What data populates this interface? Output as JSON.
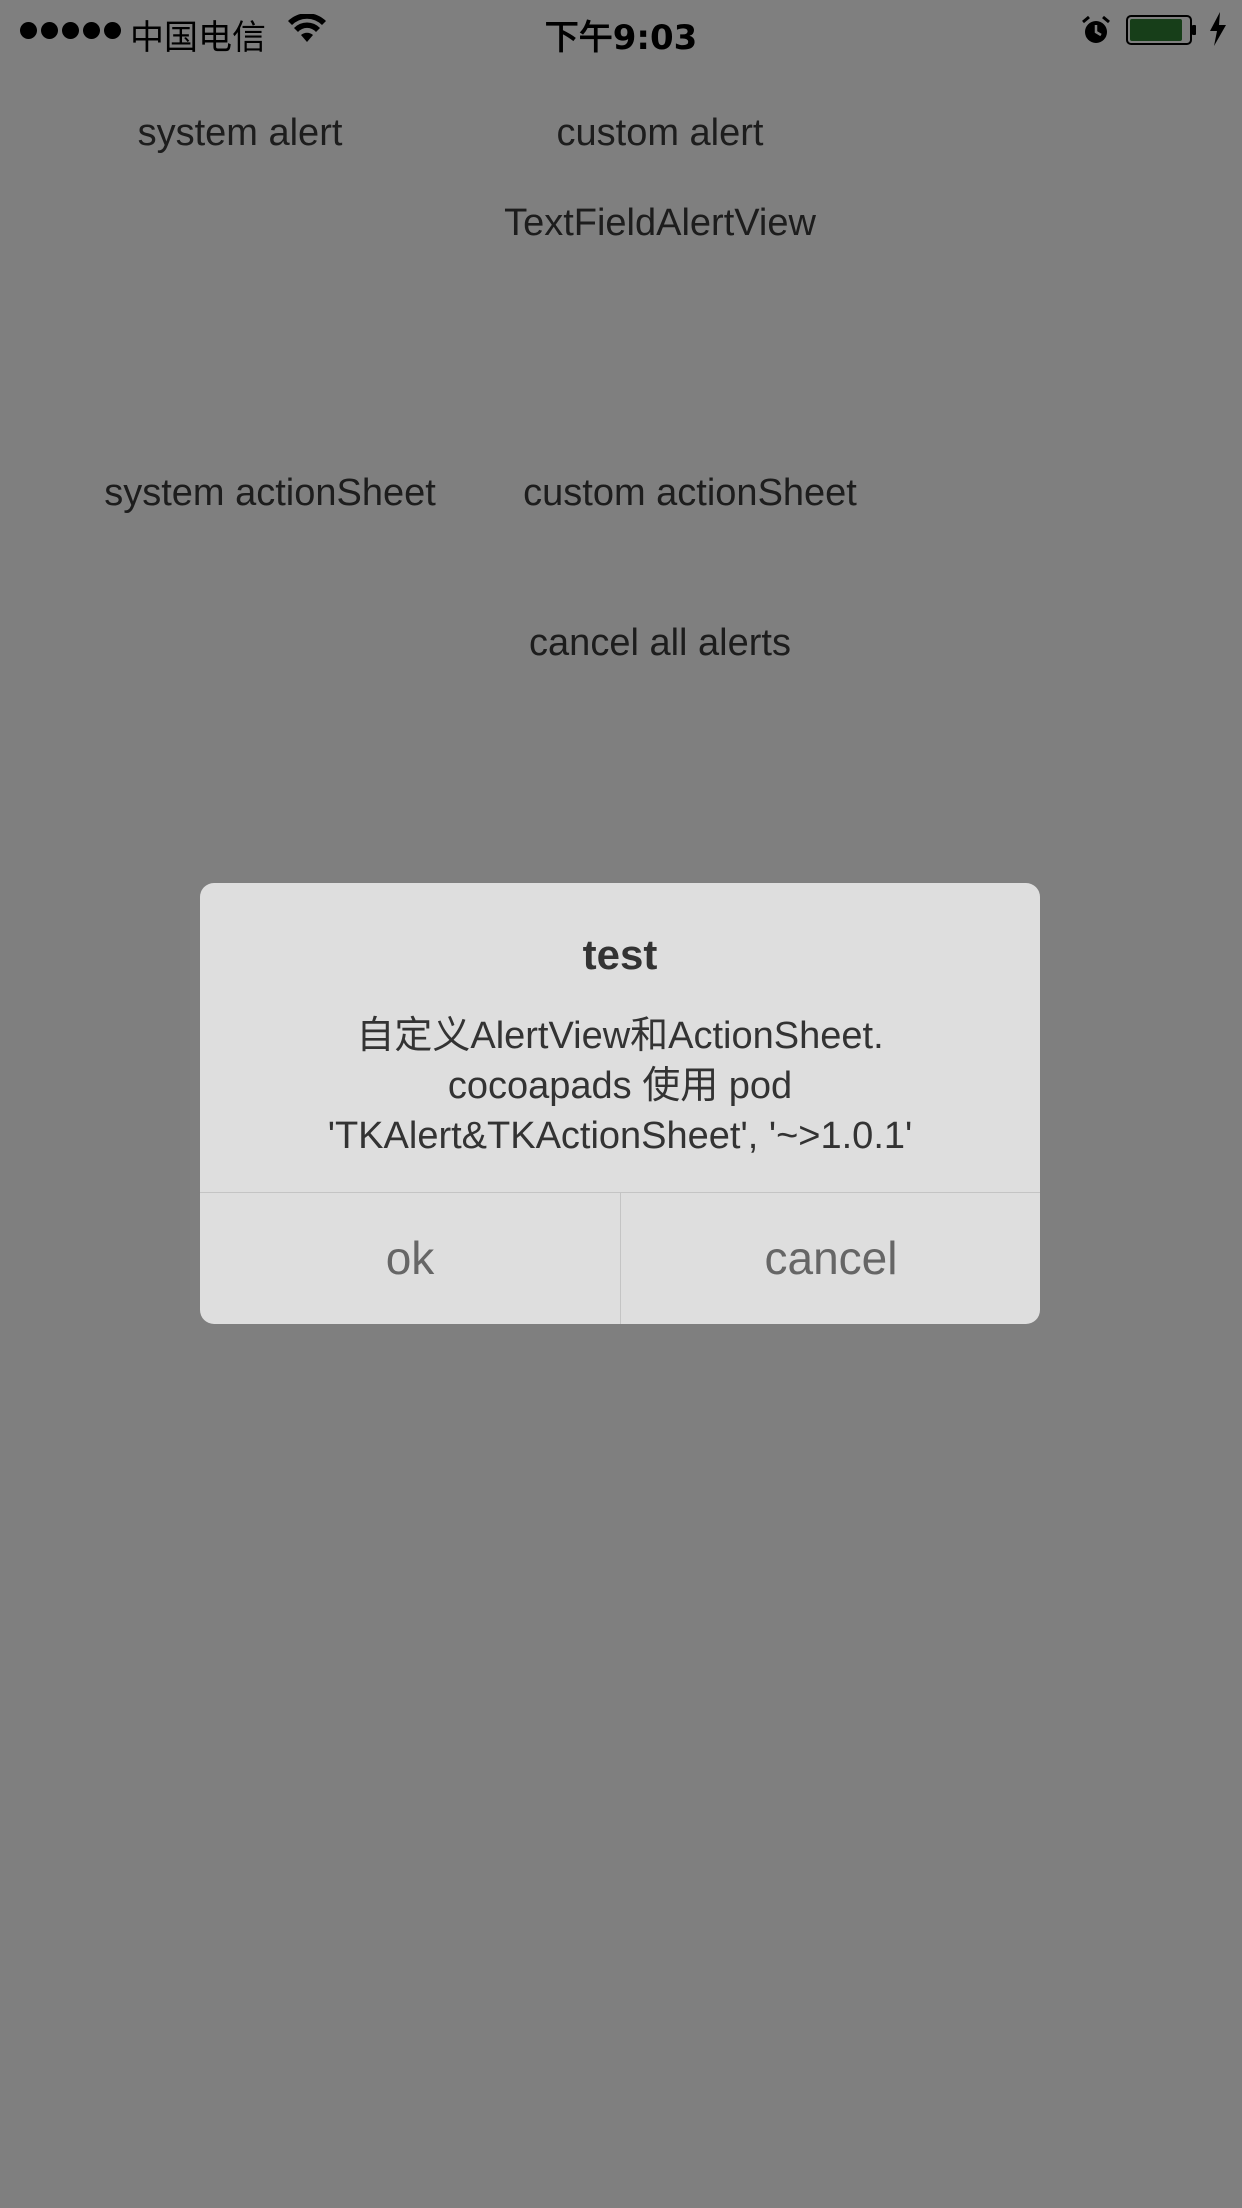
{
  "status_bar": {
    "carrier": "中国电信",
    "time": "下午9:03",
    "battery_color": "#2e7d32"
  },
  "buttons": {
    "system_alert": "system alert",
    "custom_alert": "custom alert",
    "textfield_alert": "TextFieldAlertView",
    "system_actionsheet": "system actionSheet",
    "custom_actionsheet": "custom actionSheet",
    "cancel_all": "cancel all alerts"
  },
  "alert": {
    "title": "test",
    "message_lines": [
      "自定义AlertView和ActionSheet.",
      "cocoapads 使用 pod",
      "'TKAlert&TKActionSheet', '~>1.0.1'"
    ],
    "ok_label": "ok",
    "cancel_label": "cancel"
  },
  "icons": {
    "signal": "signal-dots-icon",
    "wifi": "wifi-icon",
    "alarm": "alarm-icon",
    "battery": "battery-icon",
    "charging": "charging-bolt-icon"
  }
}
